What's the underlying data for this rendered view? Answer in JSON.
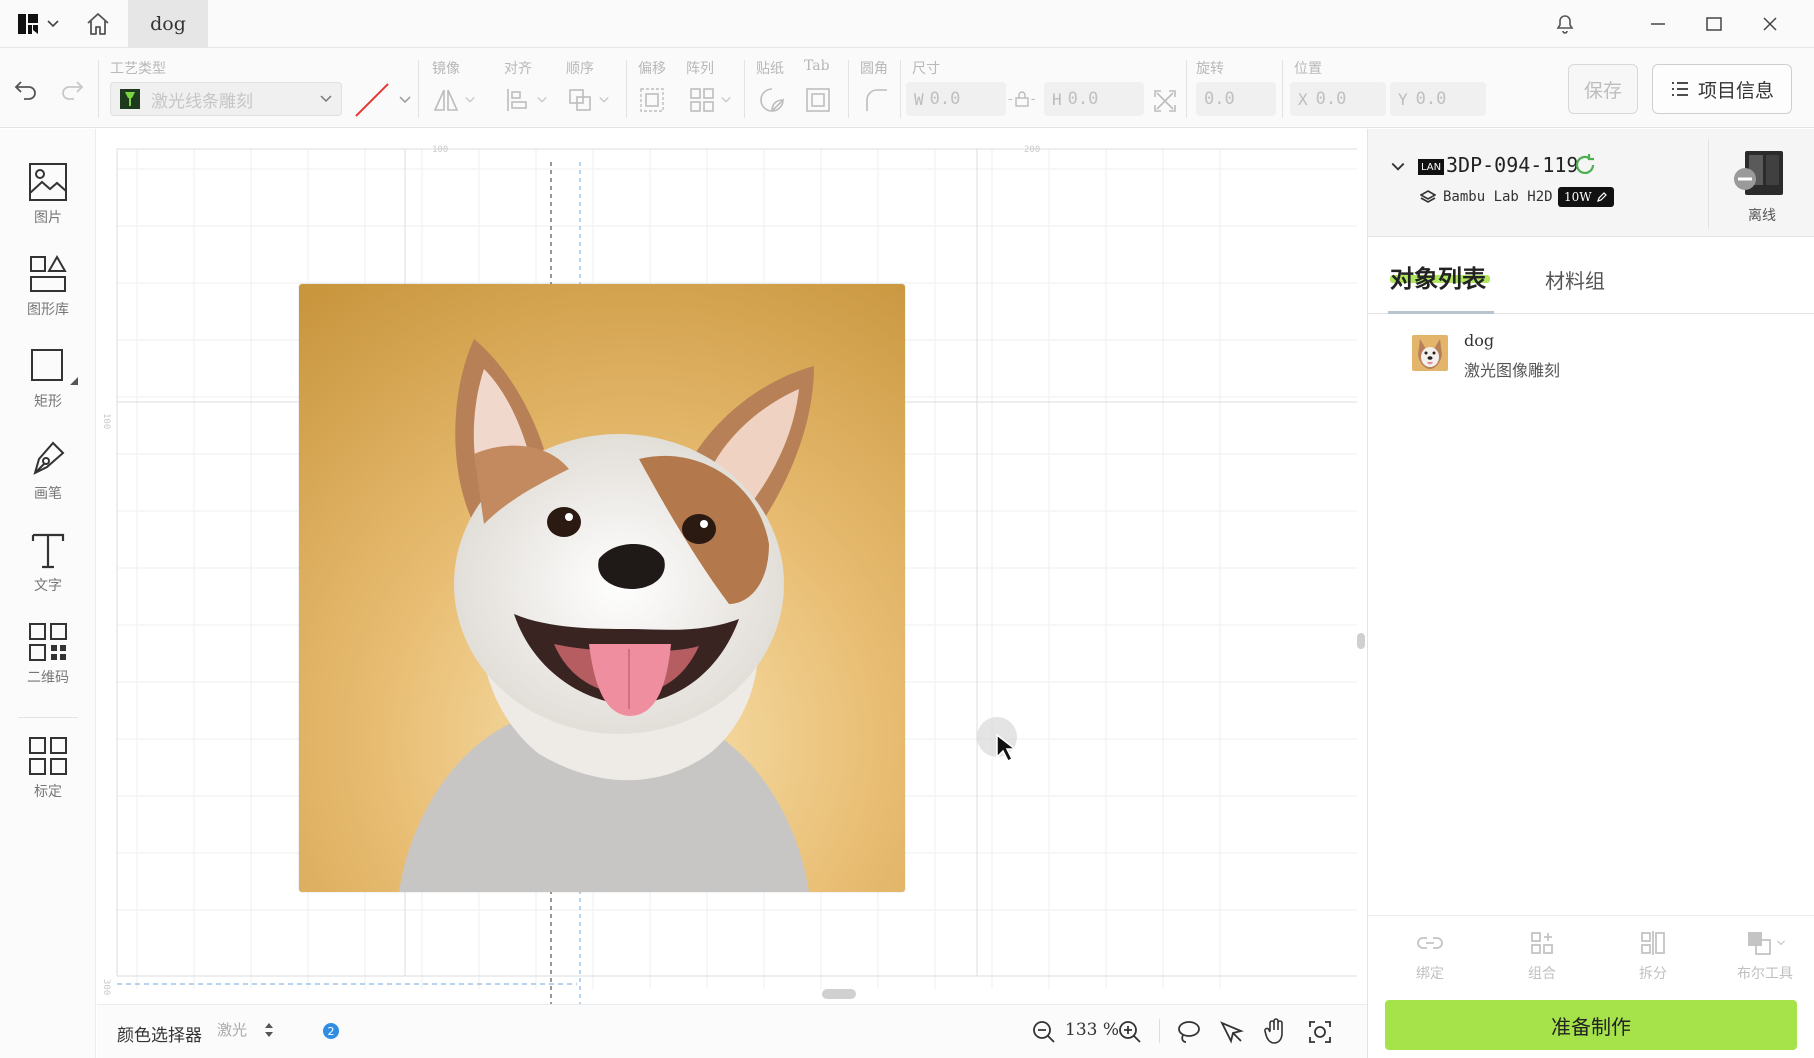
{
  "titlebar": {
    "tab_name": "dog"
  },
  "toolbar": {
    "process_type_label": "工艺类型",
    "process_type_value": "激光线条雕刻",
    "mirror_label": "镜像",
    "align_label": "对齐",
    "order_label": "顺序",
    "offset_label": "偏移",
    "array_label": "阵列",
    "sticker_label": "贴纸",
    "tab_label": "Tab",
    "corner_label": "圆角",
    "size_label": "尺寸",
    "w_prefix": "W",
    "w_value": "0.0",
    "h_prefix": "H",
    "h_value": "0.0",
    "rotate_label": "旋转",
    "rotate_value": "0.0",
    "position_label": "位置",
    "x_prefix": "X",
    "x_value": "0.0",
    "y_prefix": "Y",
    "y_value": "0.0",
    "save_label": "保存",
    "project_info_label": "项目信息"
  },
  "tools": [
    {
      "label": "图片",
      "icon": "image-icon"
    },
    {
      "label": "图形库",
      "icon": "shape-library-icon"
    },
    {
      "label": "矩形",
      "icon": "rectangle-icon"
    },
    {
      "label": "画笔",
      "icon": "pen-icon"
    },
    {
      "label": "文字",
      "icon": "text-icon"
    },
    {
      "label": "二维码",
      "icon": "qrcode-icon"
    },
    {
      "label": "标定",
      "icon": "calibrate-icon"
    }
  ],
  "canvas": {
    "ruler_top_1": "100",
    "ruler_top_2": "200",
    "ruler_left_1": "100",
    "ruler_left_2": "300"
  },
  "statusbar": {
    "color_picker_label": "颜色选择器",
    "laser_label": "激光",
    "badge_count": "2",
    "zoom_value": "133 %"
  },
  "device": {
    "name": "3DP-094-119",
    "connection": "LAN",
    "model": "Bambu Lab H2D",
    "power": "10W",
    "status": "离线"
  },
  "panel": {
    "tab_objects": "对象列表",
    "tab_materials": "材料组",
    "objects": [
      {
        "name": "dog",
        "process": "激光图像雕刻"
      }
    ],
    "bind_label": "绑定",
    "group_label": "组合",
    "split_label": "拆分",
    "boolean_label": "布尔工具",
    "prepare_label": "准备制作"
  },
  "colors": {
    "accent_green": "#a6e34b",
    "refresh_green": "#4caf50",
    "line_red": "#e53935"
  }
}
